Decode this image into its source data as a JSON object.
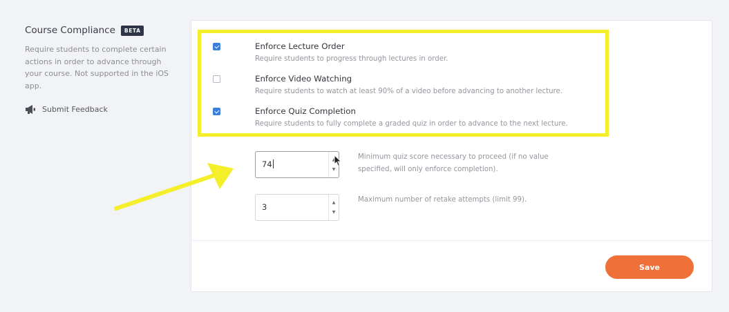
{
  "sidebar": {
    "title": "Course Compliance",
    "badge": "BETA",
    "description": "Require students to complete certain actions in order to advance through your course. Not supported in the iOS app.",
    "feedback_label": "Submit Feedback"
  },
  "options": [
    {
      "title": "Enforce Lecture Order",
      "description": "Require students to progress through lectures in order.",
      "checked": true
    },
    {
      "title": "Enforce Video Watching",
      "description": "Require students to watch at least 90% of a video before advancing to another lecture.",
      "checked": false
    },
    {
      "title": "Enforce Quiz Completion",
      "description": "Require students to fully complete a graded quiz in order to advance to the next lecture.",
      "checked": true
    }
  ],
  "quiz": {
    "min_score_value": "74",
    "min_score_help": "Minimum quiz score necessary to proceed (if no value specified, will only enforce completion).",
    "retake_value": "3",
    "retake_help": "Maximum number of retake attempts (limit 99)."
  },
  "actions": {
    "save_label": "Save"
  },
  "colors": {
    "accent": "#ef7038",
    "checkbox": "#3a7fde",
    "highlight": "#f5ee2a",
    "badge": "#2f3447"
  },
  "icons": {
    "feedback": "megaphone-icon",
    "spinner_up": "chevron-up-icon",
    "spinner_down": "chevron-down-icon"
  }
}
